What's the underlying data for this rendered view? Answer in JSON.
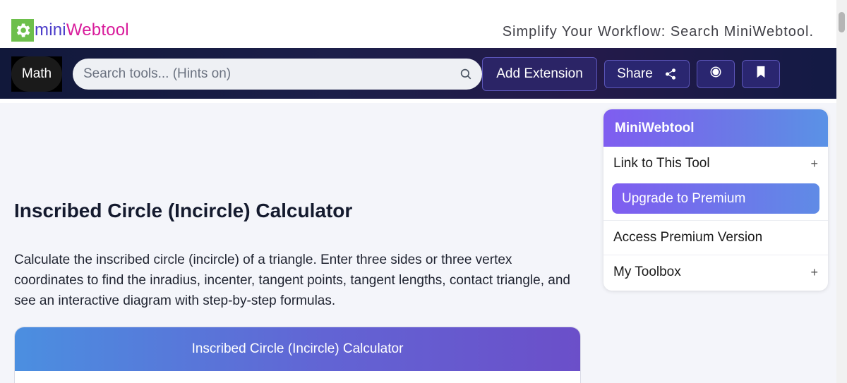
{
  "header": {
    "logo_mini": "mini",
    "logo_web": "Webtool",
    "tagline": "Simplify Your Workflow: Search MiniWebtool."
  },
  "nav": {
    "category": "Math",
    "search_placeholder": "Search tools... (Hints on)",
    "add_extension": "Add Extension",
    "share": "Share",
    "icons": {
      "search": "search-icon",
      "share": "share-icon",
      "target": "target-icon",
      "bookmark": "bookmark-icon"
    }
  },
  "main": {
    "title": "Inscribed Circle (Incircle) Calculator",
    "description": "Calculate the inscribed circle (incircle) of a triangle. Enter three sides or three vertex coordinates to find the inradius, incenter, tangent points, tangent lengths, contact triangle, and see an interactive diagram with step-by-step formulas.",
    "calculator_header": "Inscribed Circle (Incircle) Calculator"
  },
  "sidebar": {
    "header": "MiniWebtool",
    "link_to_tool": "Link to This Tool",
    "upgrade": "Upgrade to Premium",
    "access_premium": "Access Premium Version",
    "my_toolbox": "My Toolbox",
    "expand_symbol": "+"
  },
  "colors": {
    "nav_bg": "#1c1f4a",
    "logo_green": "#6dbf4b",
    "logo_purple": "#4b3cc9",
    "logo_pink": "#d81b9b",
    "accent_gradient_start": "#7f5df0",
    "accent_gradient_end": "#5a92e6"
  }
}
